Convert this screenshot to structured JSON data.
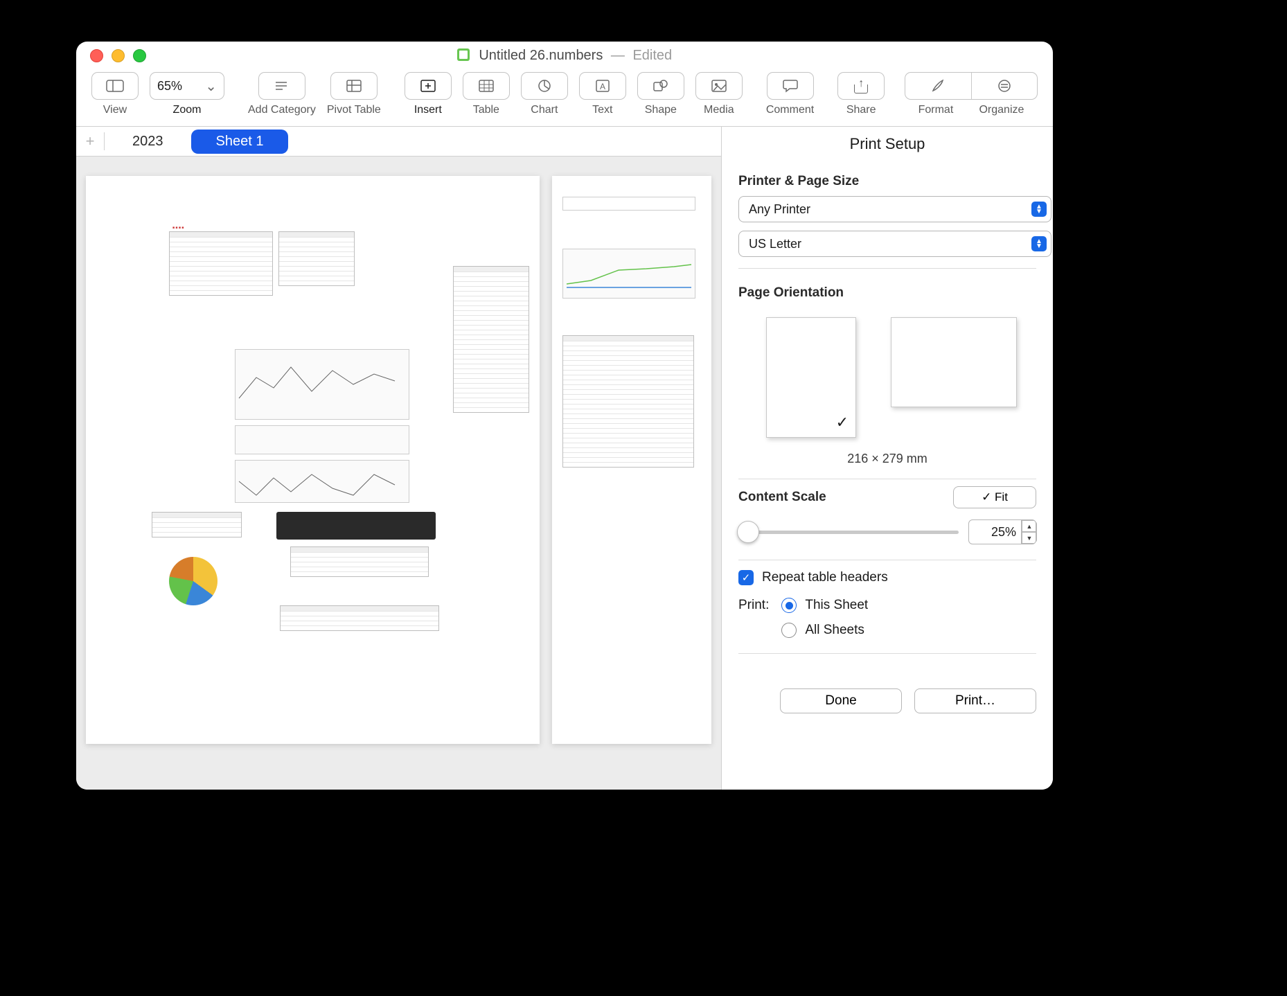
{
  "title": {
    "filename": "Untitled 26.numbers",
    "separator": "—",
    "status": "Edited"
  },
  "toolbar": {
    "zoom_value": "65%",
    "view": "View",
    "zoom": "Zoom",
    "add_category": "Add Category",
    "pivot": "Pivot Table",
    "insert": "Insert",
    "table": "Table",
    "chart": "Chart",
    "text": "Text",
    "shape": "Shape",
    "media": "Media",
    "comment": "Comment",
    "share": "Share",
    "format": "Format",
    "organize": "Organize"
  },
  "tabs": {
    "tab1": "2023",
    "tab2": "Sheet 1"
  },
  "sidebar": {
    "title": "Print Setup",
    "sec_printer": "Printer & Page Size",
    "printer": "Any Printer",
    "page_size": "US Letter",
    "sec_orient": "Page Orientation",
    "orient_dims": "216 × 279 mm",
    "sec_scale": "Content Scale",
    "fit_label": "✓ Fit",
    "scale_value": "25%",
    "repeat_headers": "Repeat table headers",
    "print_label": "Print:",
    "radio_this": "This Sheet",
    "radio_all": "All Sheets",
    "done": "Done",
    "print": "Print…"
  }
}
